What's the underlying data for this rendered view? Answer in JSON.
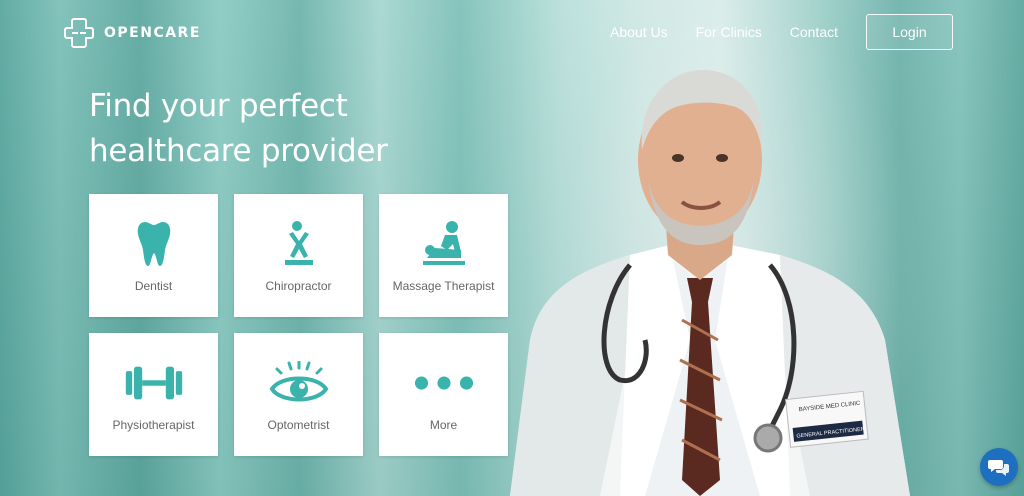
{
  "brand": {
    "name": "OPENCARE",
    "accent": "#3ab3ad"
  },
  "nav": {
    "links": [
      "About Us",
      "For Clinics",
      "Contact"
    ],
    "login_label": "Login"
  },
  "hero": {
    "headline_line1": "Find your perfect",
    "headline_line2": "healthcare provider"
  },
  "categories": [
    {
      "label": "Dentist",
      "icon": "tooth-icon"
    },
    {
      "label": "Chiropractor",
      "icon": "chiropractor-icon"
    },
    {
      "label": "Massage Therapist",
      "icon": "massage-icon"
    },
    {
      "label": "Physiotherapist",
      "icon": "dumbbell-icon"
    },
    {
      "label": "Optometrist",
      "icon": "eye-icon"
    },
    {
      "label": "More",
      "icon": "more-dots-icon"
    }
  ],
  "doctor_badge": {
    "clinic": "BAYSIDE MED CLINIC",
    "role": "GENERAL PRACTITIONER"
  },
  "chat": {
    "icon": "chat-icon"
  }
}
